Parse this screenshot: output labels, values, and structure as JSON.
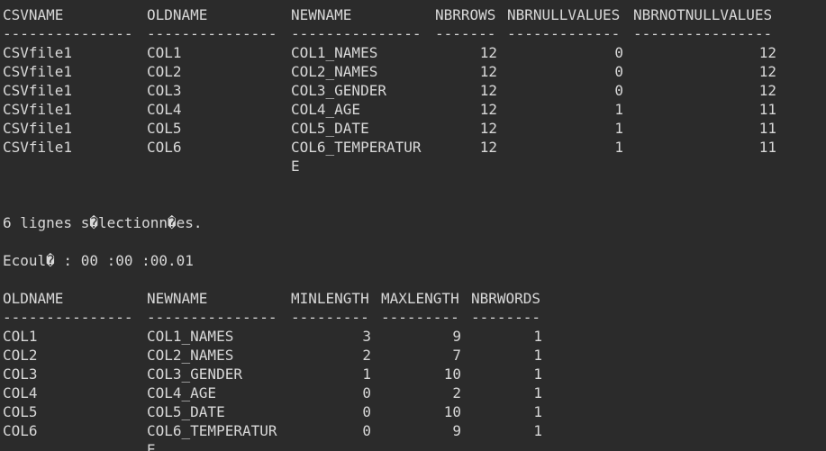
{
  "table1": {
    "headers": [
      "CSVNAME",
      "OLDNAME",
      "NEWNAME",
      "NBRROWS",
      "NBRNULLVALUES",
      "NBRNOTNULLVALUES"
    ],
    "dashes": [
      "---------------",
      "---------------",
      "---------------",
      "-------",
      "-------------",
      "----------------"
    ],
    "rows": [
      [
        "CSVfile1",
        "COL1",
        "COL1_NAMES",
        "12",
        "0",
        "12"
      ],
      [
        "CSVfile1",
        "COL2",
        "COL2_NAMES",
        "12",
        "0",
        "12"
      ],
      [
        "CSVfile1",
        "COL3",
        "COL3_GENDER",
        "12",
        "0",
        "12"
      ],
      [
        "CSVfile1",
        "COL4",
        "COL4_AGE",
        "12",
        "1",
        "11"
      ],
      [
        "CSVfile1",
        "COL5",
        "COL5_DATE",
        "12",
        "1",
        "11"
      ],
      [
        "CSVfile1",
        "COL6",
        "COL6_TEMPERATUR",
        "12",
        "1",
        "11"
      ]
    ],
    "wrap_continuation": "E"
  },
  "message_rows_selected": "6 lignes s�lectionn�es.",
  "message_elapsed": "Ecoul� : 00 :00 :00.01",
  "table2": {
    "headers": [
      "OLDNAME",
      "NEWNAME",
      "MINLENGTH",
      "MAXLENGTH",
      "NBRWORDS"
    ],
    "dashes": [
      "---------------",
      "---------------",
      "---------",
      "---------",
      "--------"
    ],
    "rows": [
      [
        "COL1",
        "COL1_NAMES",
        "3",
        "9",
        "1"
      ],
      [
        "COL2",
        "COL2_NAMES",
        "2",
        "7",
        "1"
      ],
      [
        "COL3",
        "COL3_GENDER",
        "1",
        "10",
        "1"
      ],
      [
        "COL4",
        "COL4_AGE",
        "0",
        "2",
        "1"
      ],
      [
        "COL5",
        "COL5_DATE",
        "0",
        "10",
        "1"
      ],
      [
        "COL6",
        "COL6_TEMPERATUR",
        "0",
        "9",
        "1"
      ]
    ],
    "wrap_continuation": "E"
  }
}
